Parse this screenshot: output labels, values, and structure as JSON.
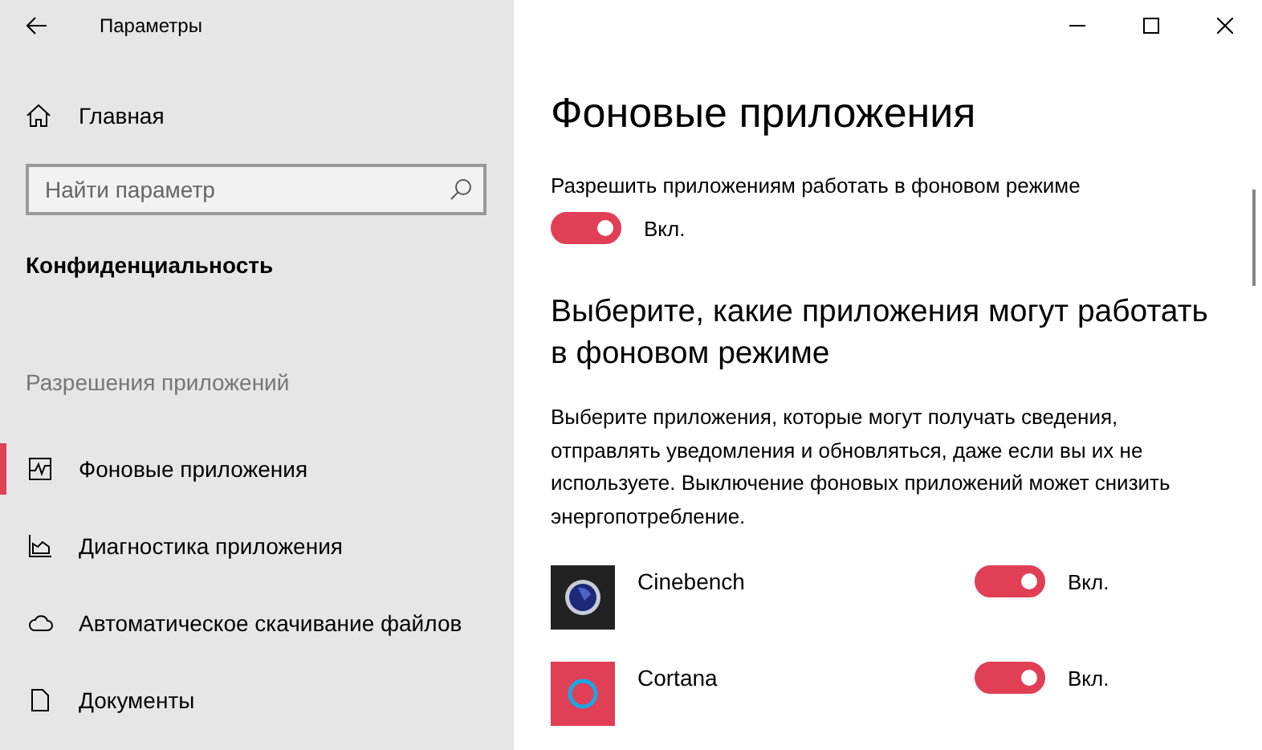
{
  "window": {
    "title": "Параметры"
  },
  "sidebar": {
    "home": "Главная",
    "search": {
      "placeholder": "Найти параметр"
    },
    "section": "Конфиденциальность",
    "group": "Разрешения приложений",
    "items": [
      {
        "label": "Фоновые приложения",
        "kind": "activity",
        "selected": true
      },
      {
        "label": "Диагностика приложения",
        "kind": "diagnostics",
        "selected": false
      },
      {
        "label": "Автоматическое скачивание файлов",
        "kind": "cloud",
        "selected": false
      },
      {
        "label": "Документы",
        "kind": "document",
        "selected": false
      }
    ]
  },
  "main": {
    "title": "Фоновые приложения",
    "allow_label": "Разрешить приложениям работать в фоновом режиме",
    "allow_toggle": {
      "on": true,
      "state_label": "Вкл."
    },
    "heading": "Выберите, какие приложения могут работать в фоновом режиме",
    "description": "Выберите приложения, которые могут получать сведения, отправлять уведомления и обновляться, даже если вы их не используете. Выключение фоновых приложений может снизить энергопотребление.",
    "apps": [
      {
        "name": "Cinebench",
        "kind": "cinebench",
        "on": true,
        "state_label": "Вкл."
      },
      {
        "name": "Cortana",
        "kind": "cortana",
        "on": true,
        "state_label": "Вкл."
      }
    ]
  }
}
